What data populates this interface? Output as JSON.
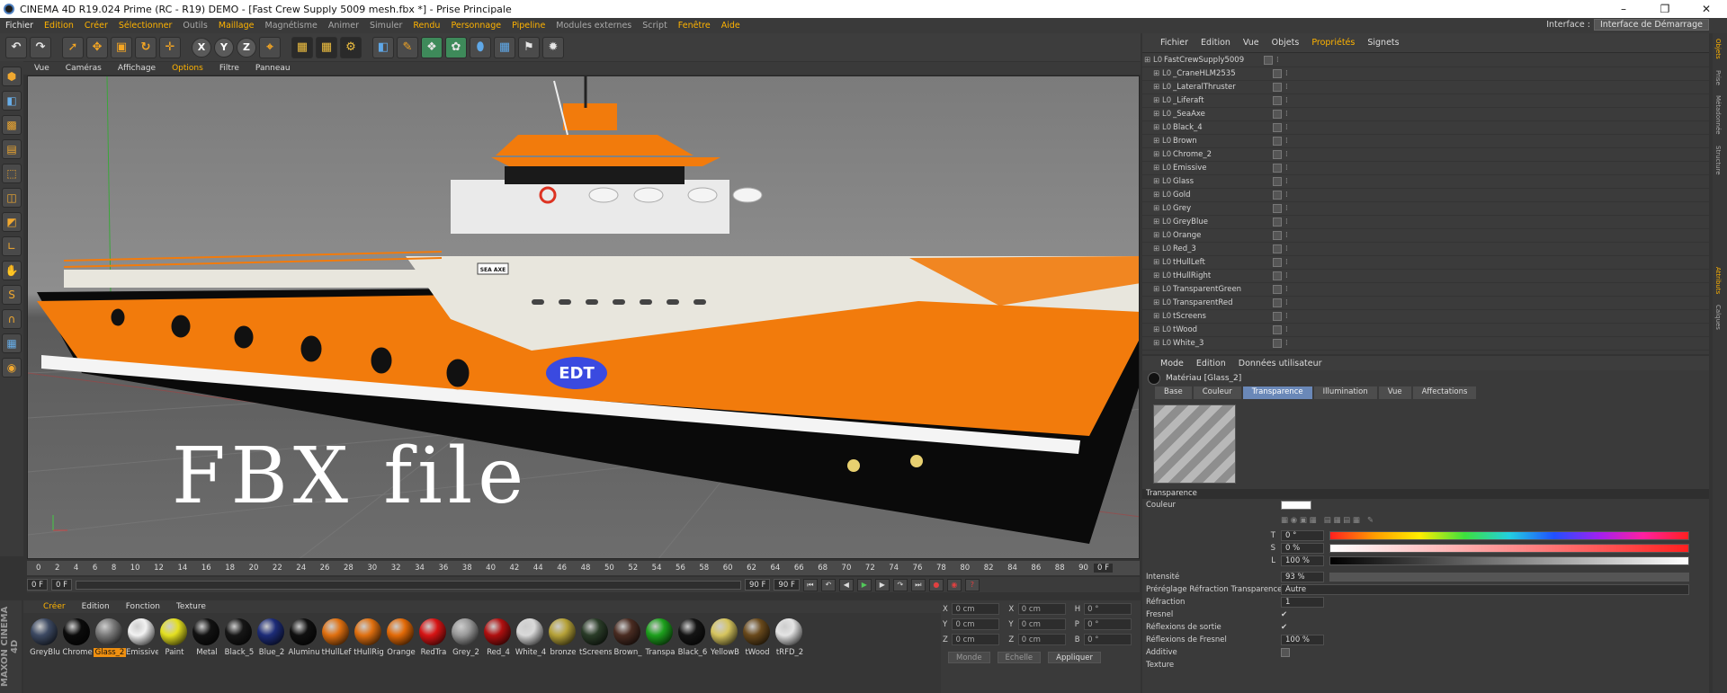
{
  "window": {
    "title": "CINEMA 4D R19.024 Prime (RC - R19) DEMO - [Fast Crew Supply 5009 mesh.fbx *] - Prise Principale",
    "controls": [
      "–",
      "❐",
      "✕"
    ]
  },
  "menubar": {
    "items": [
      "Fichier",
      "Edition",
      "Créer",
      "Sélectionner",
      "Outils",
      "Maillage",
      "Magnétisme",
      "Animer",
      "Simuler",
      "Rendu",
      "Personnage",
      "Pipeline",
      "Modules externes",
      "Script",
      "Fenêtre",
      "Aide"
    ],
    "interface_label": "Interface :",
    "interface_value": "Interface de Démarrage"
  },
  "viewport": {
    "menu": [
      "Vue",
      "Caméras",
      "Affichage",
      "Options",
      "Filtre",
      "Panneau"
    ],
    "overlay_text": "FBX file",
    "boat_hull_texts": [
      "EDT",
      "SEA AXE"
    ]
  },
  "timeline": {
    "ticks": [
      "0",
      "2",
      "4",
      "6",
      "8",
      "10",
      "12",
      "14",
      "16",
      "18",
      "20",
      "22",
      "24",
      "26",
      "28",
      "30",
      "32",
      "34",
      "36",
      "38",
      "40",
      "42",
      "44",
      "46",
      "48",
      "50",
      "52",
      "54",
      "56",
      "58",
      "60",
      "62",
      "64",
      "66",
      "68",
      "70",
      "72",
      "74",
      "76",
      "78",
      "80",
      "82",
      "84",
      "86",
      "88",
      "90"
    ],
    "current_frame": "0 F",
    "start_field": "0 F",
    "start_field2": "0 F",
    "end_field": "90 F",
    "end_field2": "90 F"
  },
  "material_manager": {
    "menu": [
      "Créer",
      "Edition",
      "Fonction",
      "Texture"
    ],
    "materials": [
      {
        "name": "GreyBlu",
        "color": "#3d4a63"
      },
      {
        "name": "Chrome",
        "color": "#0b0b0b"
      },
      {
        "name": "Glass_2",
        "color": "#7a7a7a",
        "selected": true
      },
      {
        "name": "Emissive",
        "color": "#f2f2f2"
      },
      {
        "name": "Paint",
        "color": "#e4e020"
      },
      {
        "name": "Metal",
        "color": "#121212"
      },
      {
        "name": "Black_5",
        "color": "#161616"
      },
      {
        "name": "Blue_2",
        "color": "#1d2c78"
      },
      {
        "name": "Aluminu",
        "color": "#101010"
      },
      {
        "name": "tHullLef",
        "color": "#e07010"
      },
      {
        "name": "tHullRig",
        "color": "#e07010"
      },
      {
        "name": "Orange",
        "color": "#e36a07"
      },
      {
        "name": "RedTra",
        "color": "#d71414"
      },
      {
        "name": "Grey_2",
        "color": "#9a9a9a"
      },
      {
        "name": "Red_4",
        "color": "#b01010"
      },
      {
        "name": "White_4",
        "color": "#d9d9d9"
      },
      {
        "name": "bronze",
        "color": "#b6a238"
      },
      {
        "name": "tScreens",
        "color": "#2a3c28"
      },
      {
        "name": "Brown_",
        "color": "#4a2c22"
      },
      {
        "name": "Transpa",
        "color": "#1da01d"
      },
      {
        "name": "Black_6",
        "color": "#141414"
      },
      {
        "name": "YellowB",
        "color": "#d6c55e"
      },
      {
        "name": "tWood",
        "color": "#6a4a1c"
      },
      {
        "name": "tRFD_2",
        "color": "#e4e4e4"
      }
    ]
  },
  "coords": {
    "rows": [
      {
        "a": "X",
        "av": "0 cm",
        "b": "X",
        "bv": "0 cm",
        "c": "H",
        "cv": "0 °"
      },
      {
        "a": "Y",
        "av": "0 cm",
        "b": "Y",
        "bv": "0 cm",
        "c": "P",
        "cv": "0 °"
      },
      {
        "a": "Z",
        "av": "0 cm",
        "b": "Z",
        "bv": "0 cm",
        "c": "B",
        "cv": "0 °"
      }
    ],
    "mode1": "Monde",
    "mode2": "Echelle",
    "apply": "Appliquer"
  },
  "object_manager": {
    "menu": [
      "Fichier",
      "Edition",
      "Vue",
      "Objets",
      "Propriétés",
      "Signets"
    ],
    "objects": [
      "FastCrewSupply5009",
      "_CraneHLM2535",
      "_LateralThruster",
      "_Liferaft",
      "_SeaAxe",
      "Black_4",
      "Brown",
      "Chrome_2",
      "Emissive",
      "Glass",
      "Gold",
      "Grey",
      "GreyBlue",
      "Orange",
      "Red_3",
      "tHullLeft",
      "tHullRight",
      "TransparentGreen",
      "TransparentRed",
      "tScreens",
      "tWood",
      "White_3"
    ]
  },
  "attributes": {
    "menu": [
      "Mode",
      "Edition",
      "Données utilisateur"
    ],
    "material_name": "Matériau [Glass_2]",
    "tabs": [
      "Base",
      "Couleur",
      "Transparence",
      "Illumination",
      "Vue",
      "Affectations"
    ],
    "active_tab": "Transparence",
    "section": "Transparence",
    "color_label": "Couleur",
    "t_label": "T",
    "t_value": "0 °",
    "s_label": "S",
    "s_value": "0 %",
    "l_label": "L",
    "l_value": "100 %",
    "intensity_label": "Intensité",
    "intensity_value": "93 %",
    "preset_label": "Préréglage Réfraction Transparence",
    "preset_value": "Autre",
    "refraction_label": "Réfraction",
    "refraction_value": "1",
    "fresnel_label": "Fresnel",
    "exit_label": "Réflexions de sortie",
    "fresnel_refl_label": "Réflexions de Fresnel",
    "fresnel_refl_value": "100 %",
    "additive_label": "Additive",
    "texture_label": "Texture"
  },
  "side_tabs": [
    "Objets",
    "Prise",
    "Métadonnée",
    "Structure"
  ],
  "side_tabs2": [
    "Attributs",
    "Calques"
  ]
}
